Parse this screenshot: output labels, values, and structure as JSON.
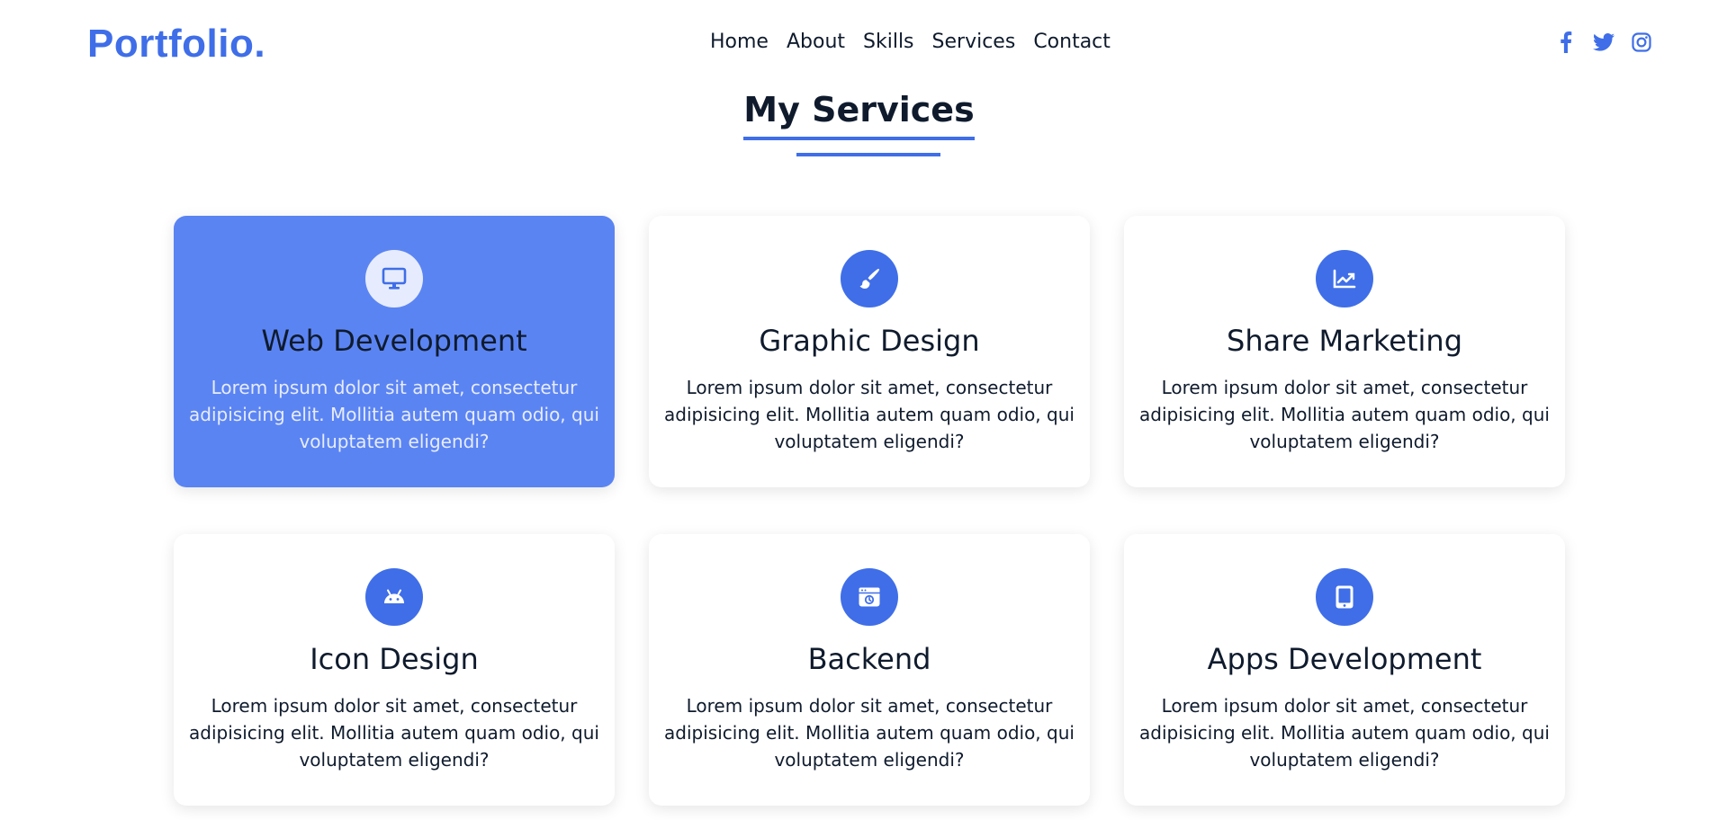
{
  "header": {
    "logo": "Portfolio.",
    "nav": [
      "Home",
      "About",
      "Skills",
      "Services",
      "Contact"
    ],
    "social": [
      "facebook-icon",
      "twitter-icon",
      "instagram-icon"
    ]
  },
  "section": {
    "title": "My Services"
  },
  "services": [
    {
      "title": "Web Development",
      "icon": "monitor-icon",
      "desc": "Lorem ipsum dolor sit amet, consectetur adipisicing elit. Mollitia autem quam odio, qui voluptatem eligendi?",
      "active": true
    },
    {
      "title": "Graphic Design",
      "icon": "paintbrush-icon",
      "desc": "Lorem ipsum dolor sit amet, consectetur adipisicing elit. Mollitia autem quam odio, qui voluptatem eligendi?",
      "active": false
    },
    {
      "title": "Share Marketing",
      "icon": "chart-line-icon",
      "desc": "Lorem ipsum dolor sit amet, consectetur adipisicing elit. Mollitia autem quam odio, qui voluptatem eligendi?",
      "active": false
    },
    {
      "title": "Icon Design",
      "icon": "android-icon",
      "desc": "Lorem ipsum dolor sit amet, consectetur adipisicing elit. Mollitia autem quam odio, qui voluptatem eligendi?",
      "active": false
    },
    {
      "title": "Backend",
      "icon": "browser-window-icon",
      "desc": "Lorem ipsum dolor sit amet, consectetur adipisicing elit. Mollitia autem quam odio, qui voluptatem eligendi?",
      "active": false
    },
    {
      "title": "Apps Development",
      "icon": "tablet-icon",
      "desc": "Lorem ipsum dolor sit amet, consectetur adipisicing elit. Mollitia autem quam odio, qui voluptatem eligendi?",
      "active": false
    }
  ],
  "colors": {
    "accent": "#3f6ee8",
    "active_card": "#5b84f3",
    "text": "#0f1b2d"
  }
}
